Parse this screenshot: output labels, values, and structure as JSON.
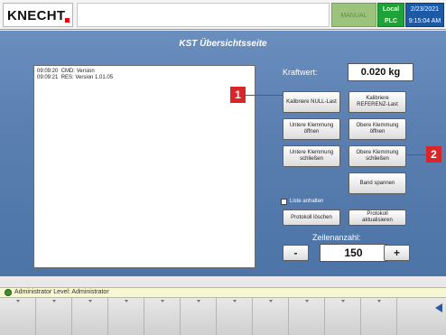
{
  "header": {
    "logo_text": "KNECHT",
    "mode": "MANUAL",
    "control": [
      "Local",
      "PLC"
    ],
    "date": "2/23/2021",
    "time": "9:15:04 AM"
  },
  "main": {
    "title": "KST Übersichtsseite",
    "log_lines": [
      "09:09:20  CMD: Version",
      "09:09:21  RES: Version 1.01.05"
    ],
    "kraftwert_label": "Kraftwert:",
    "kraftwert_value": "0.020 kg",
    "buttons": {
      "kalibriere_null": "Kalibriere NULL-Last",
      "kalibriere_ref": "Kalibriere REFERENZ-Last",
      "untere_oeffnen": "Untere Klemmung öffnen",
      "obere_oeffnen": "Obere Klemmung öffnen",
      "untere_schliessen": "Untere Klemmung schließen",
      "obere_schliessen": "Obere Klemmung schließen",
      "band_spannen": "Band spannen",
      "protokoll_loeschen": "Protokoll löschen",
      "protokoll_aktualisieren": "Protokoll aktualisieren"
    },
    "liste_anhalten": "Liste anhalten",
    "zeilenanzahl_label": "Zeilenanzahl:",
    "zeilenanzahl_value": "150",
    "minus": "-",
    "plus": "+"
  },
  "callouts": [
    "1",
    "2"
  ],
  "statusbar": {
    "user": "Administrator",
    "level": "Level: Administrator"
  },
  "colors": {
    "panel_blue": "#5a7fb0",
    "mode_green": "#9bc37b",
    "status_green": "#1ea23a",
    "datetime_blue": "#1d5aa6",
    "callout_red": "#d9262b"
  }
}
